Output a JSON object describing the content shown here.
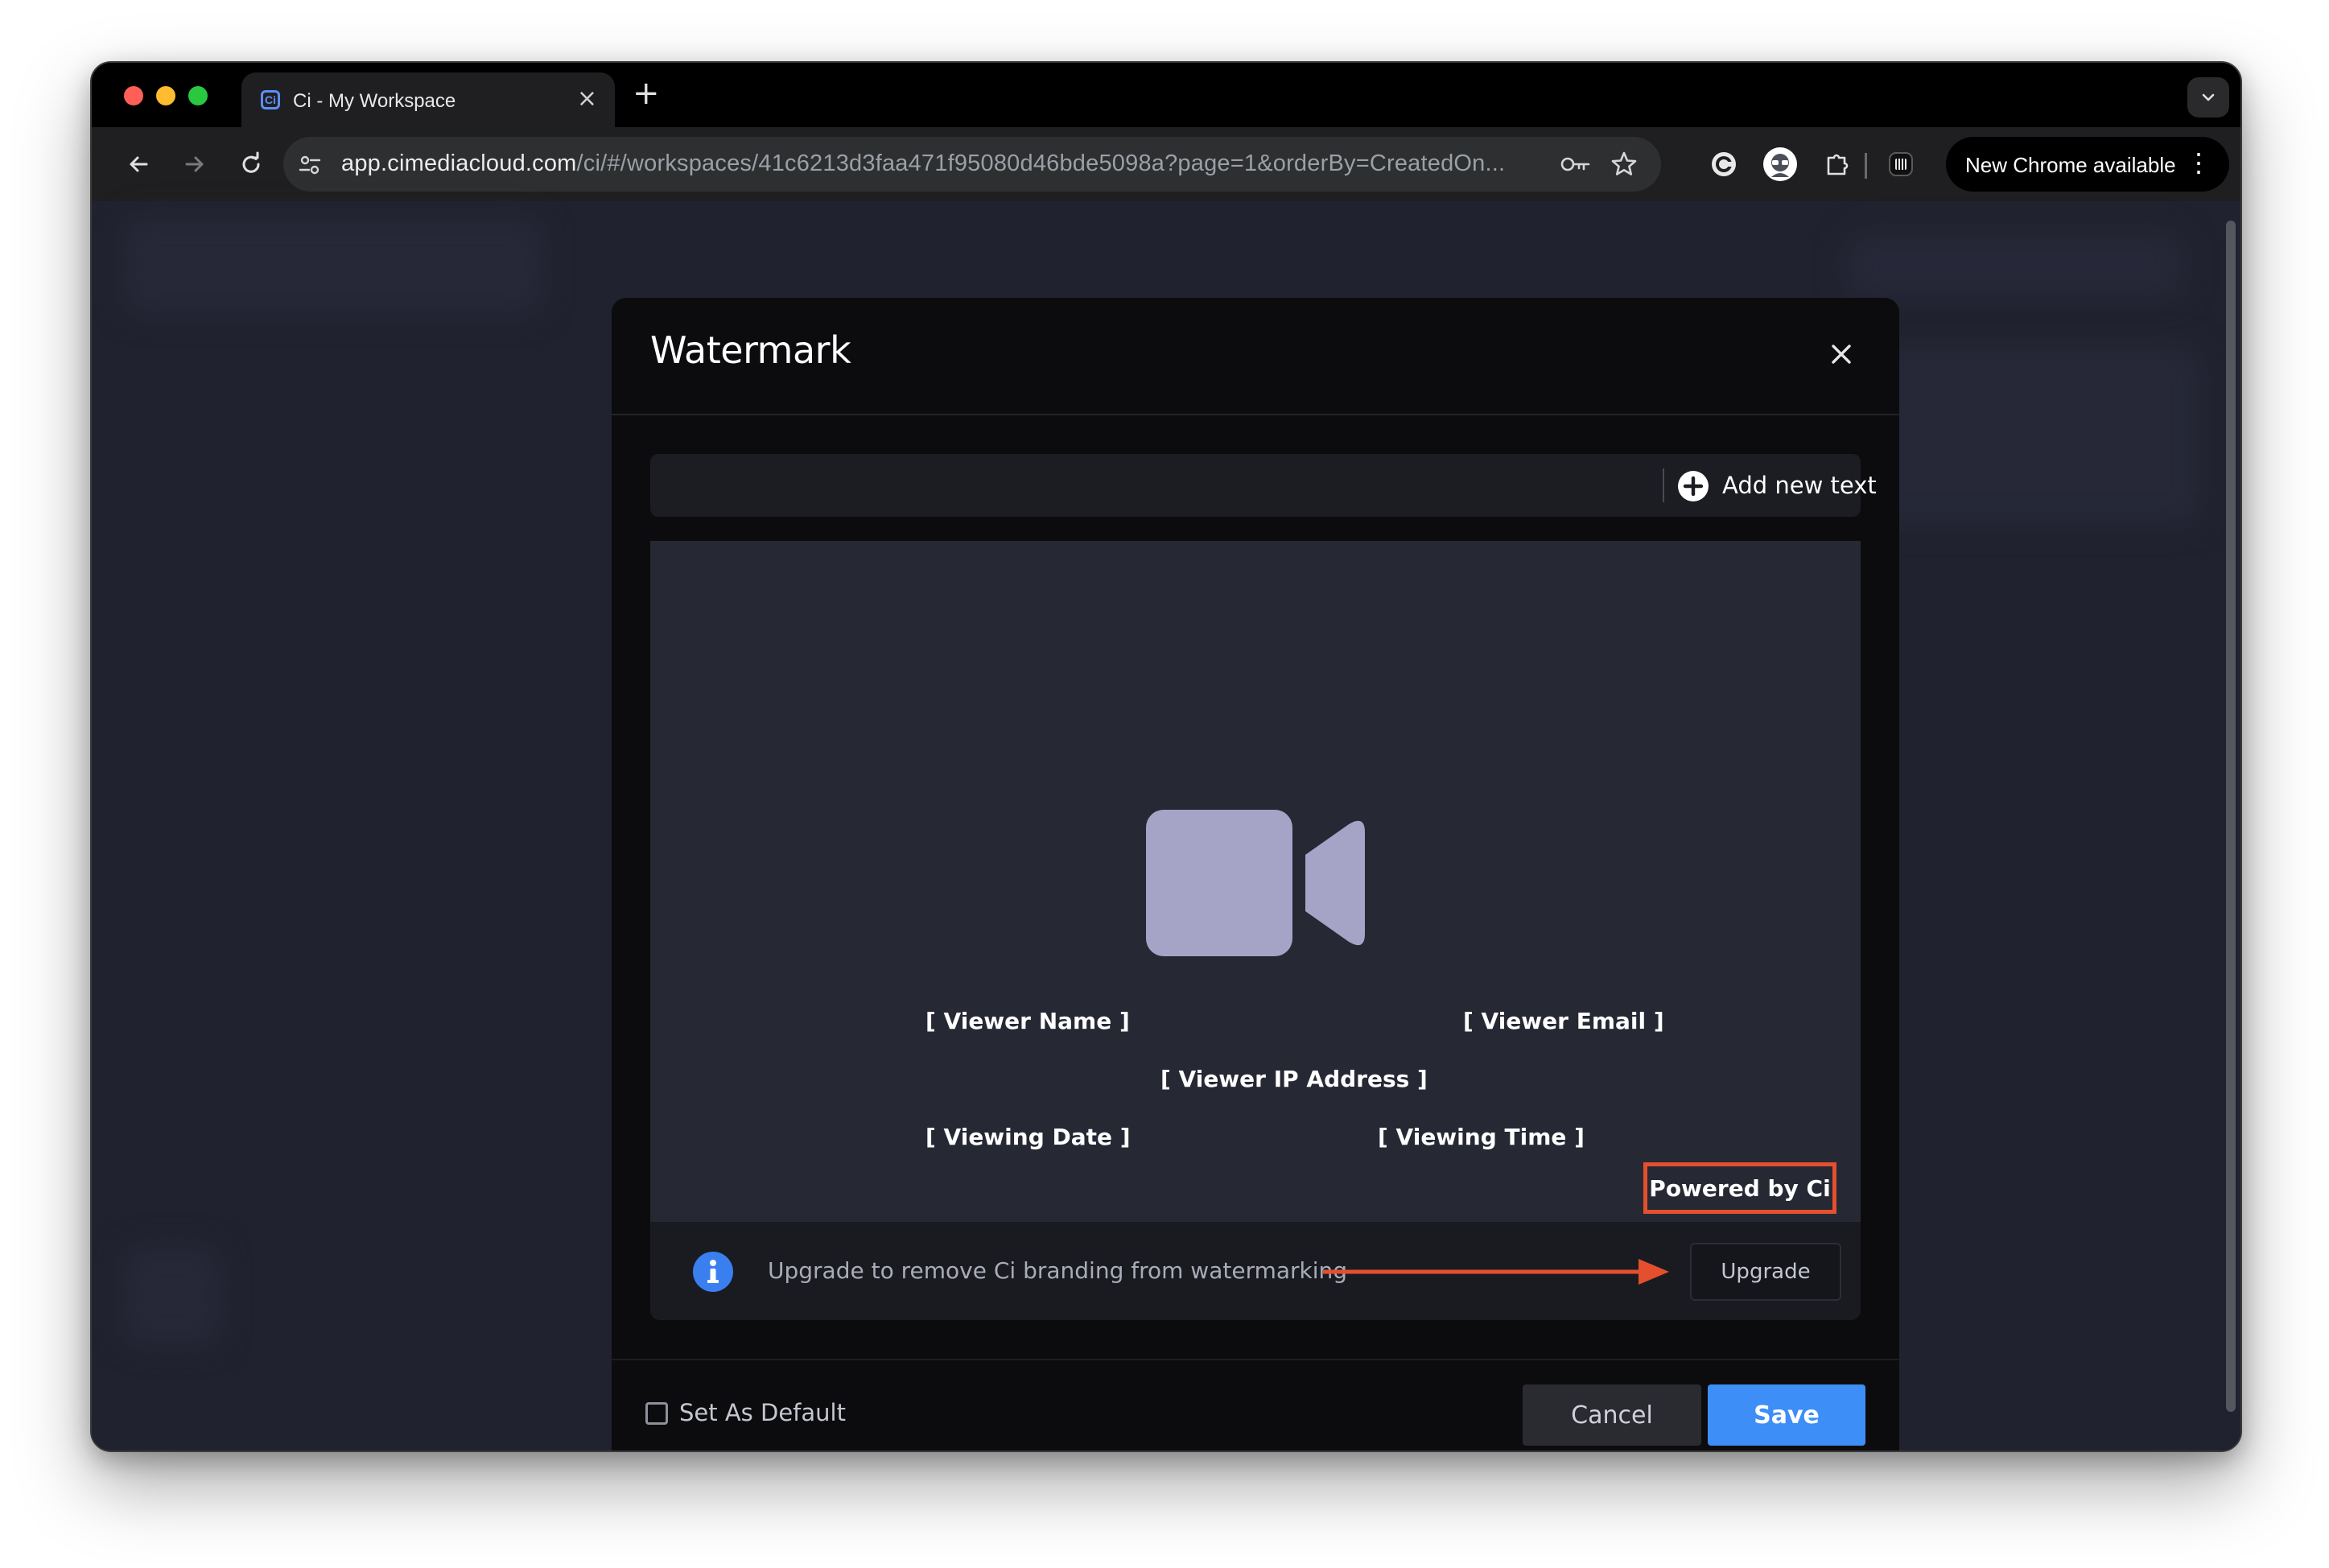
{
  "browser": {
    "tab_title": "Ci - My Workspace",
    "tab_favicon_text": "Ci",
    "tab_close_glyph": "×",
    "new_tab_glyph": "+",
    "url_host": "app.cimediacloud.com",
    "url_path": "/ci/#/workspaces/41c6213d3faa471f95080d46bde5098a?page=1&orderBy=CreatedOn...",
    "update_button_label": "New Chrome available",
    "update_menu_glyph": "⋮"
  },
  "modal": {
    "title": "Watermark",
    "close_glyph": "×",
    "add_text_label": "Add new text",
    "watermark_fields": {
      "viewer_name": "[ Viewer Name ]",
      "viewer_email": "[ Viewer Email ]",
      "viewer_ip": "[ Viewer IP Address ]",
      "viewing_date": "[ Viewing Date ]",
      "viewing_time": "[ Viewing Time ]"
    },
    "branding_label": "Powered by Ci",
    "upgrade_notice": "Upgrade to remove Ci branding from watermarking",
    "upgrade_button": "Upgrade",
    "set_default_label": "Set As Default",
    "cancel_button": "Cancel",
    "save_button": "Save"
  },
  "colors": {
    "accent_blue": "#3d8ef7",
    "highlight_red": "#e4502e",
    "camera_icon": "#a5a4c6",
    "preview_bg": "#262834"
  },
  "icons": {
    "back": "arrow-left-icon",
    "forward": "arrow-right-icon",
    "reload": "reload-icon",
    "site_settings": "tune-icon",
    "password": "key-icon",
    "bookmark": "star-icon",
    "add_text": "plus-circle-icon",
    "preview_placeholder": "video-camera-icon",
    "info": "info-icon"
  }
}
